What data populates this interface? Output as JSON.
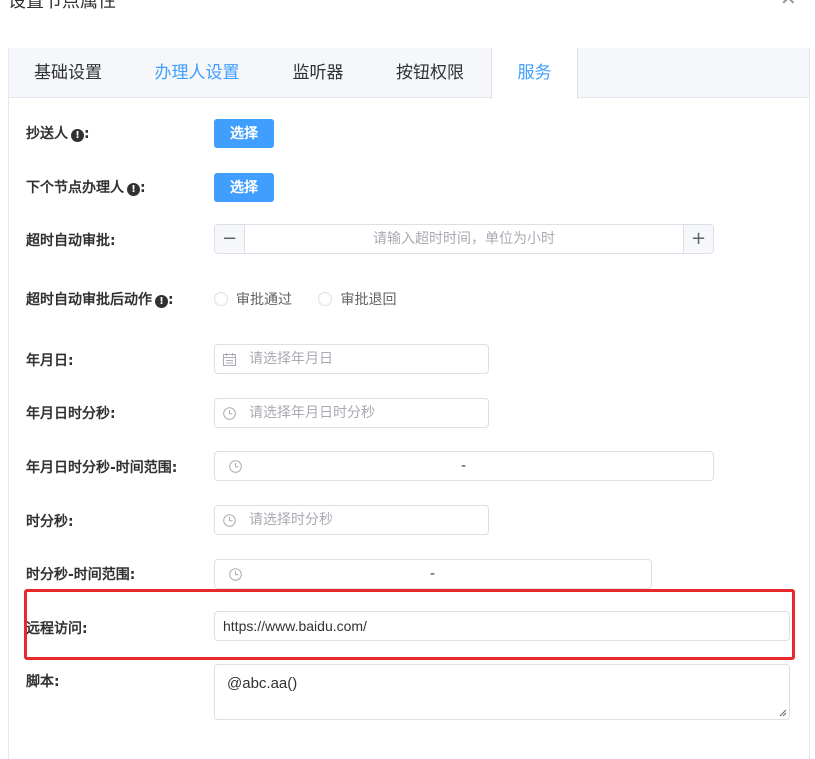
{
  "dialog": {
    "title": "设置节点属性",
    "close_icon": "close-icon"
  },
  "tabs": [
    {
      "label": "基础设置"
    },
    {
      "label": "办理人设置"
    },
    {
      "label": "监听器"
    },
    {
      "label": "按钮权限"
    },
    {
      "label": "服务"
    }
  ],
  "form": {
    "cc": {
      "label": "抄送人",
      "button": "选择"
    },
    "next_assignee": {
      "label": "下个节点办理人",
      "button": "选择"
    },
    "timeout_auto": {
      "label": "超时自动审批:",
      "placeholder": "请输入超时时间，单位为小时",
      "dec": "−",
      "inc": "+"
    },
    "timeout_action": {
      "label": "超时自动审批后动作",
      "options": [
        "审批通过",
        "审批退回"
      ]
    },
    "date": {
      "label": "年月日:",
      "placeholder": "请选择年月日"
    },
    "datetime": {
      "label": "年月日时分秒:",
      "placeholder": "请选择年月日时分秒"
    },
    "datetime_range": {
      "label": "年月日时分秒-时间范围:",
      "separator": "-"
    },
    "time": {
      "label": "时分秒:",
      "placeholder": "请选择时分秒"
    },
    "time_range": {
      "label": "时分秒-时间范围:",
      "separator": "-"
    },
    "remote": {
      "label": "远程访问:",
      "value": "https://www.baidu.com/"
    },
    "script": {
      "label": "脚本:",
      "value": "@abc.aa()"
    }
  },
  "colors": {
    "primary": "#409eff",
    "highlight": "#e8282b"
  }
}
